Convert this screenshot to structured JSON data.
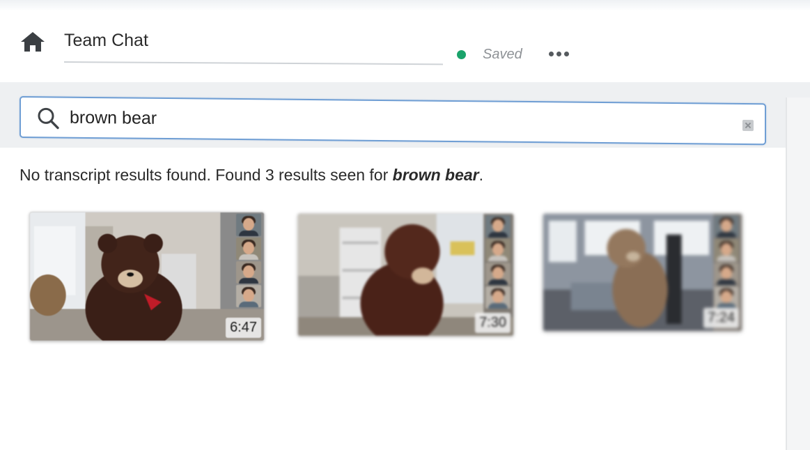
{
  "header": {
    "title": "Team Chat",
    "status": "Saved",
    "status_color": "#1aa36b",
    "home_icon": "home-icon",
    "more_icon": "more-horizontal-icon"
  },
  "search": {
    "value": "brown bear",
    "icon": "search-icon",
    "clear_icon": "clear-icon"
  },
  "results": {
    "message_prefix": "No transcript results found. Found 3 results seen for ",
    "query": "brown bear",
    "message_suffix": ".",
    "items": [
      {
        "duration": "6:47",
        "participants": 4
      },
      {
        "duration": "7:30",
        "participants": 4
      },
      {
        "duration": "7:24",
        "participants": 4
      }
    ]
  }
}
